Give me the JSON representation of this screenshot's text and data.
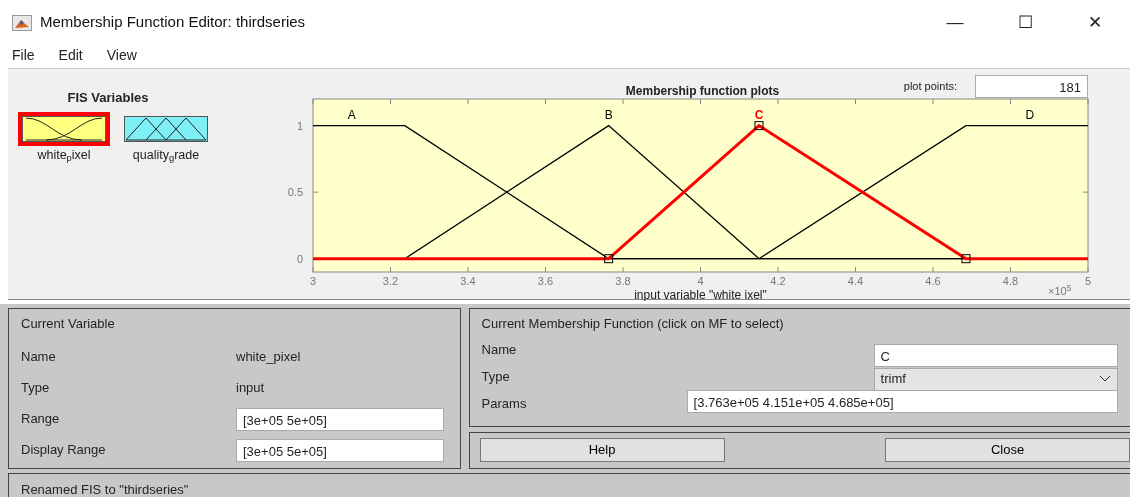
{
  "window": {
    "title": "Membership Function Editor: thirdseries",
    "controls": [
      "—",
      "☐",
      "✕"
    ]
  },
  "menu": [
    "File",
    "Edit",
    "View"
  ],
  "fis_variables": {
    "title": "FIS Variables",
    "items": [
      {
        "label": "white$_{p}$ixel",
        "kind": "input",
        "selected": true
      },
      {
        "label": "quality$_{g}$rade",
        "kind": "output",
        "selected": false
      }
    ]
  },
  "plot": {
    "plot_points_label": "plot points:",
    "plot_points": "181",
    "exponent_label": "×10$^{5}$",
    "chart_data": {
      "type": "line",
      "title": "Membership function plots",
      "xlabel": "input variable \"white ixel\"",
      "x": [
        3,
        3.237,
        3.763,
        4.151,
        4.685,
        5
      ],
      "series": [
        {
          "name": "A",
          "color": "#000000",
          "values": [
            1,
            1,
            0,
            0,
            0,
            0
          ]
        },
        {
          "name": "B",
          "color": "#000000",
          "values": [
            0,
            0,
            1,
            0,
            0,
            0
          ]
        },
        {
          "name": "C",
          "color": "#ff0000",
          "values": [
            0,
            0,
            0,
            1,
            0,
            0
          ]
        },
        {
          "name": "D",
          "color": "#000000",
          "values": [
            0,
            0,
            0,
            0,
            1,
            1
          ]
        }
      ],
      "xlim": [
        3,
        5
      ],
      "ylim": [
        -0.1,
        1.2
      ],
      "xticks": [
        3,
        {
          "value": 3.2,
          "label": "3.2"
        },
        {
          "value": 3.4,
          "label": "3.4"
        },
        {
          "value": 3.6,
          "label": "3.6"
        },
        {
          "value": 3.8,
          "label": "3.8"
        },
        4,
        {
          "value": 4.2,
          "label": "4.2"
        },
        {
          "value": 4.4,
          "label": "4.4"
        },
        {
          "value": 4.6,
          "label": "4.6"
        },
        {
          "value": 4.8,
          "label": "4.8"
        },
        5
      ],
      "yticks": [
        0,
        0.5,
        1
      ]
    }
  },
  "current_variable": {
    "title": "Current Variable",
    "rows": [
      {
        "label": "Name",
        "value": "white_pixel",
        "kind": "text"
      },
      {
        "label": "Type",
        "value": "input",
        "kind": "text"
      },
      {
        "label": "Range",
        "value": "[3e+05 5e+05]",
        "kind": "field"
      },
      {
        "label": "Display Range",
        "value": "[3e+05 5e+05]",
        "kind": "field"
      }
    ]
  },
  "current_mf": {
    "title": "Current Membership Function (click on MF to select)",
    "rows": [
      {
        "label": "Name",
        "value": "C",
        "kind": "field"
      },
      {
        "label": "Type",
        "value": "trimf",
        "kind": "dropdown"
      },
      {
        "label": "Params",
        "value": "[3.763e+05 4.151e+05 4.685e+05]",
        "kind": "wide"
      }
    ]
  },
  "buttons": [
    "Help",
    "Close"
  ],
  "status_bar": "Renamed FIS to \"thirdseries\""
}
